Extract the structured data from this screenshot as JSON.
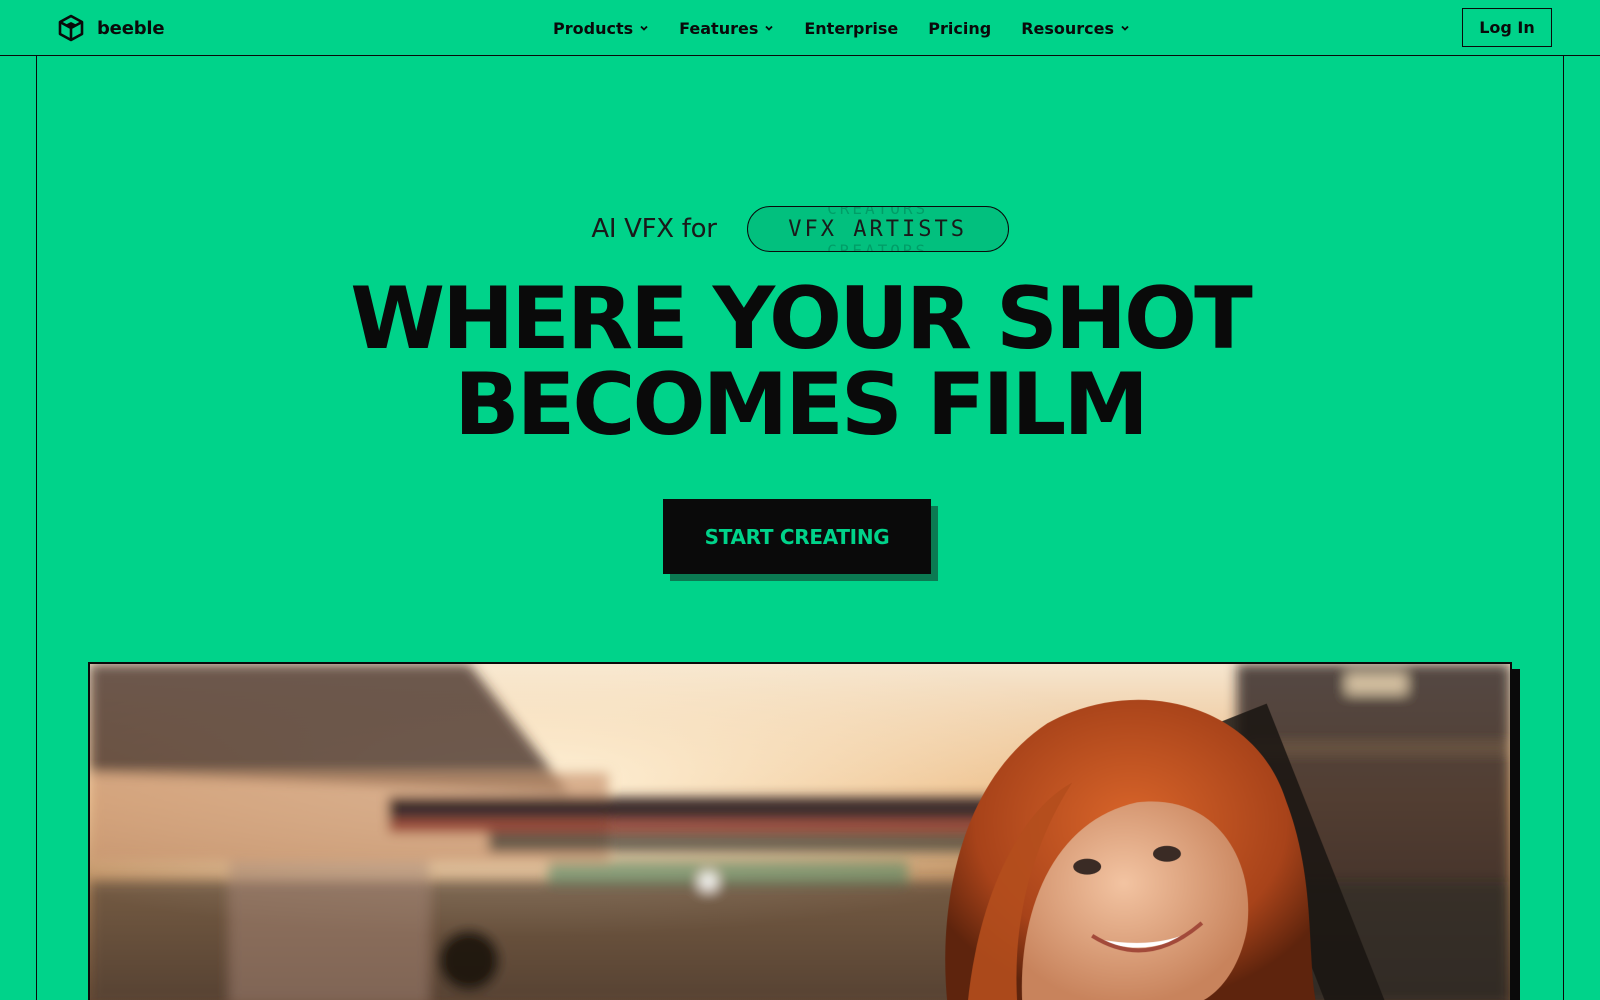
{
  "brand": {
    "name": "beeble",
    "icon": "cube-logo-icon"
  },
  "nav": {
    "items": [
      {
        "label": "Products",
        "has_dropdown": true
      },
      {
        "label": "Features",
        "has_dropdown": true
      },
      {
        "label": "Enterprise",
        "has_dropdown": false
      },
      {
        "label": "Pricing",
        "has_dropdown": false
      },
      {
        "label": "Resources",
        "has_dropdown": true
      }
    ],
    "login_label": "Log In"
  },
  "hero": {
    "eyebrow": "AI VFX for",
    "rotating_current": "VFX ARTISTS",
    "rotating_next": "CREATORS",
    "headline_line1": "WHERE YOUR SHOT",
    "headline_line2": "BECOMES FILM",
    "cta_label": "START CREATING"
  },
  "colors": {
    "background": "#00d38a",
    "ink": "#0a0a0a",
    "cta_text": "#00d38a",
    "cta_shadow": "#0b7a52"
  }
}
